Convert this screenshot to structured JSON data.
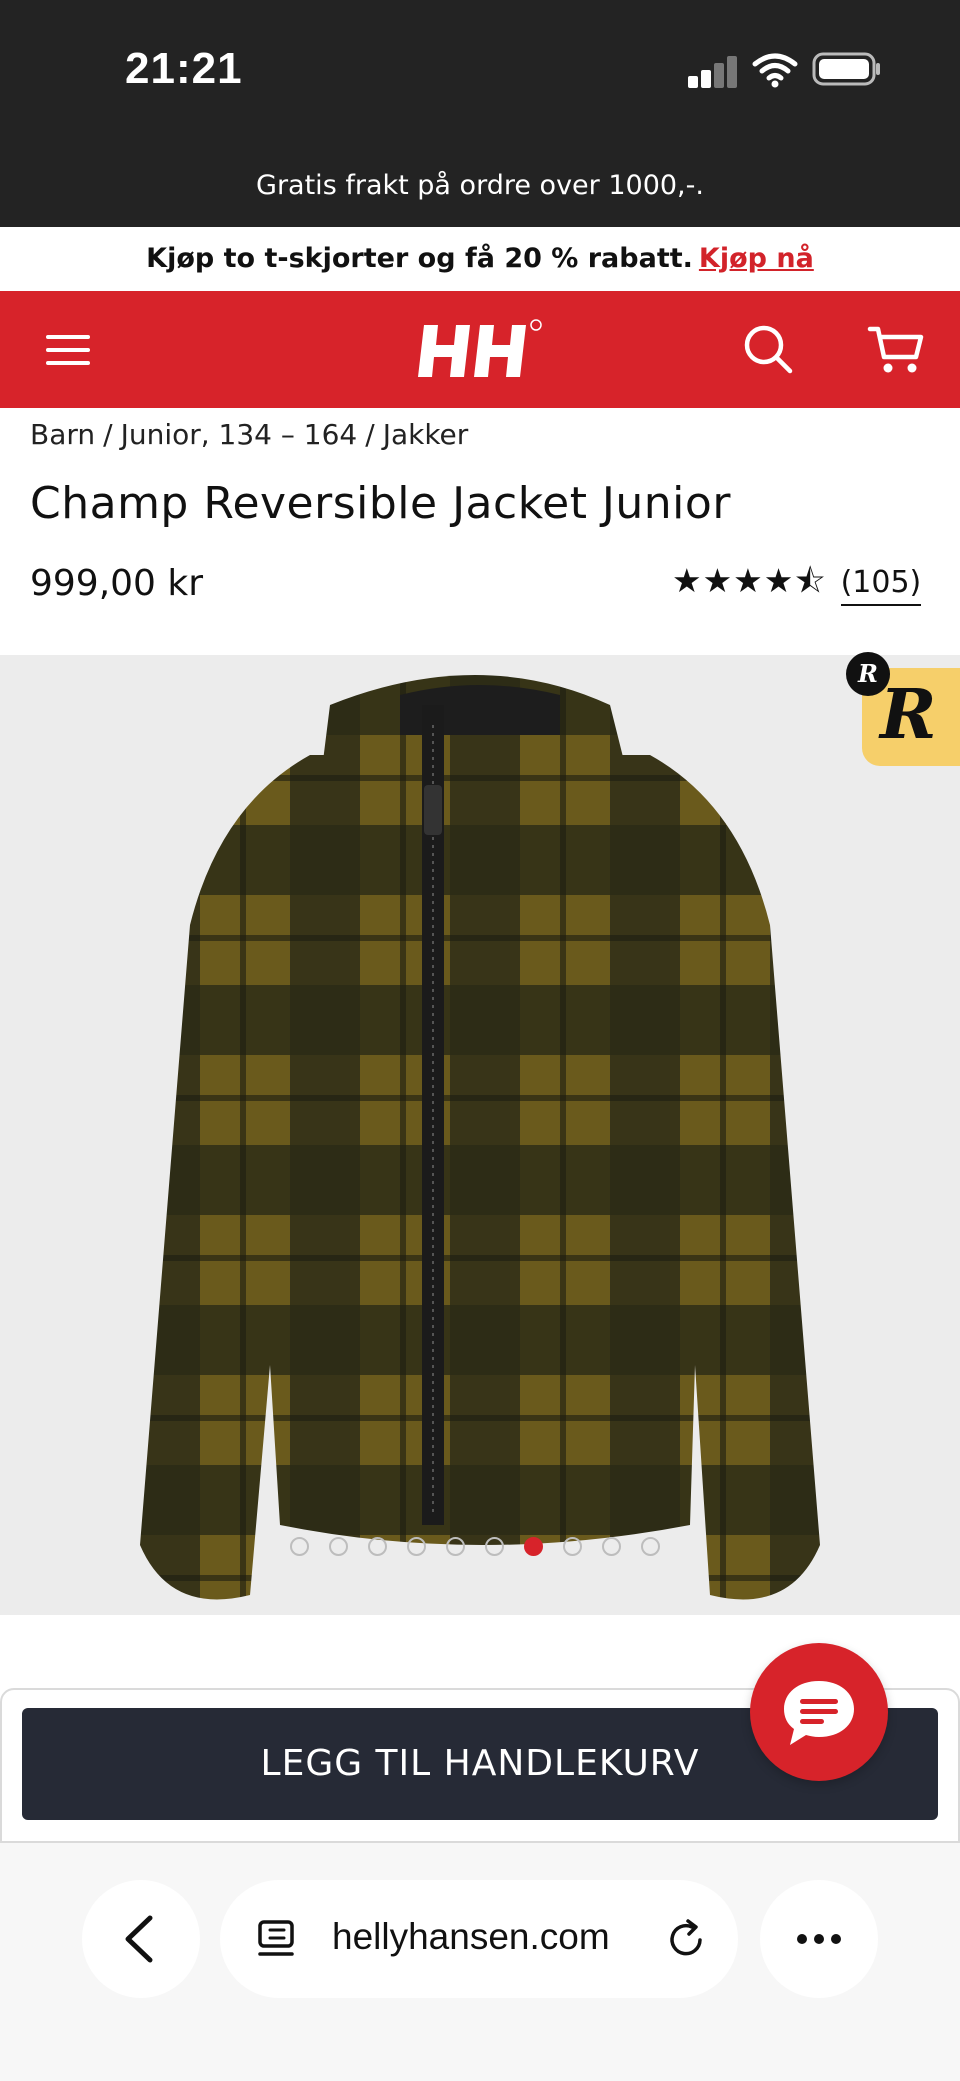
{
  "status_bar": {
    "time": "21:21"
  },
  "shipping_banner": {
    "text": "Gratis frakt på ordre over 1000,-."
  },
  "promo_banner": {
    "text": "Kjøp to t-skjorter og få 20 % rabatt.",
    "link": "Kjøp nå"
  },
  "header": {
    "logo_text": "HH"
  },
  "breadcrumb": [
    "Barn",
    "/",
    "Junior, 134 – 164",
    "/",
    "Jakker"
  ],
  "product": {
    "title": "Champ Reversible Jacket Junior",
    "price": "999,00 kr",
    "rating": 4.5,
    "stars": "★★★★⯪",
    "review_count": "(105)"
  },
  "gallery": {
    "image_count": 10,
    "active_index": 6
  },
  "cart": {
    "add_to_cart_label": "LEGG TIL HANDLEKURV"
  },
  "browser": {
    "url": "hellyhansen.com"
  },
  "colors": {
    "brand_red": "#d7232a",
    "dark": "#232323",
    "button_dark": "#262a36",
    "badge_yellow": "#f6cf6a"
  }
}
